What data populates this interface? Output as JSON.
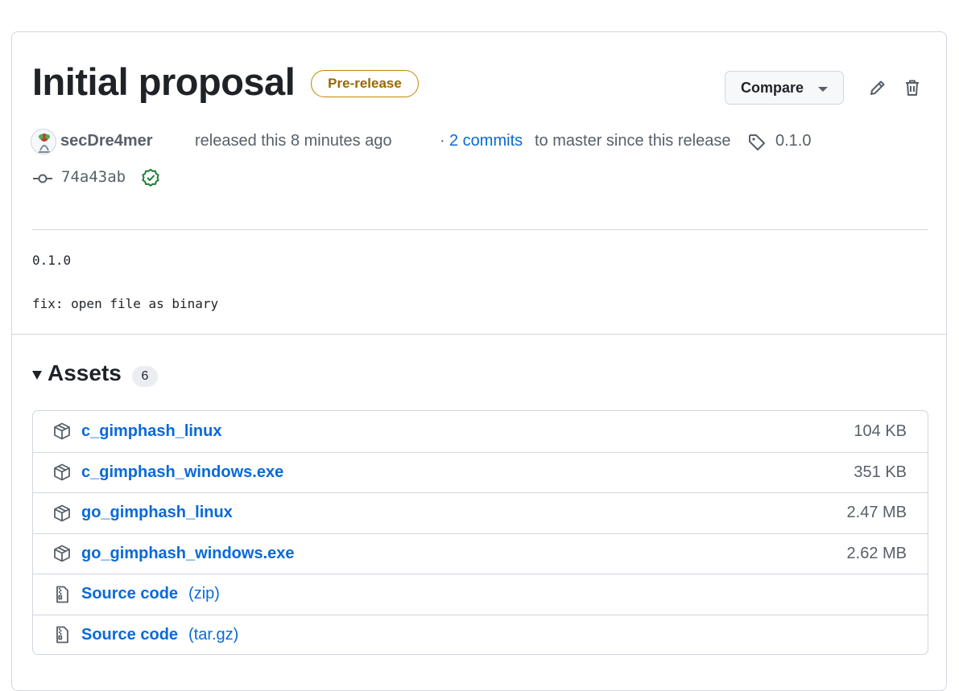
{
  "release": {
    "title": "Initial proposal",
    "badge": "Pre-release",
    "compare_label": "Compare",
    "author": "secDre4mer",
    "released_text": "released this 8 minutes ago",
    "separator": "·",
    "commits_link": "2 commits",
    "since_text": "to master since this release",
    "tag": "0.1.0",
    "commit_sha": "74a43ab",
    "body_lines": [
      "0.1.0",
      "fix: open file as binary"
    ]
  },
  "assets": {
    "title": "Assets",
    "count": "6",
    "items": [
      {
        "name": "c_gimphash_linux",
        "ext": "",
        "size": "104 KB",
        "icon": "package-icon"
      },
      {
        "name": "c_gimphash_windows.exe",
        "ext": "",
        "size": "351 KB",
        "icon": "package-icon"
      },
      {
        "name": "go_gimphash_linux",
        "ext": "",
        "size": "2.47 MB",
        "icon": "package-icon"
      },
      {
        "name": "go_gimphash_windows.exe",
        "ext": "",
        "size": "2.62 MB",
        "icon": "package-icon"
      },
      {
        "name": "Source code",
        "ext": "(zip)",
        "size": "",
        "icon": "file-zip-icon"
      },
      {
        "name": "Source code",
        "ext": "(tar.gz)",
        "size": "",
        "icon": "file-zip-icon"
      }
    ]
  },
  "colors": {
    "link": "#0969da",
    "prerelease_border": "#bf8700",
    "prerelease_text": "#9a6700",
    "verified": "#1a7f37",
    "muted": "#57606a"
  }
}
